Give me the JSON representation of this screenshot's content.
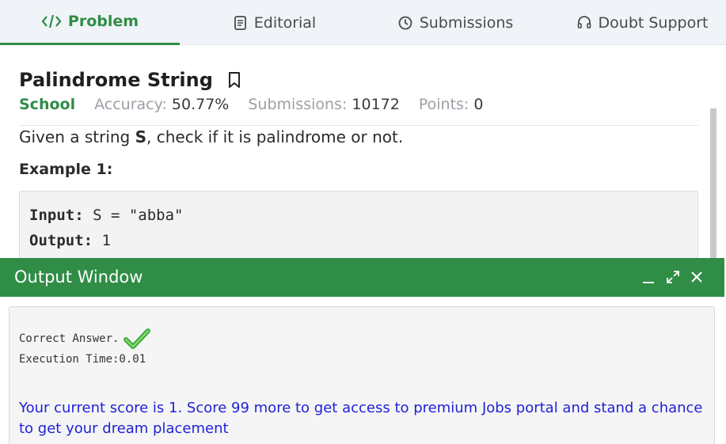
{
  "tabs": [
    {
      "label": "Problem",
      "icon": "code-icon",
      "active": true
    },
    {
      "label": "Editorial",
      "icon": "document-icon",
      "active": false
    },
    {
      "label": "Submissions",
      "icon": "clock-icon",
      "active": false
    },
    {
      "label": "Doubt Support",
      "icon": "headset-icon",
      "active": false
    }
  ],
  "problem": {
    "title": "Palindrome String",
    "level": "School",
    "accuracy_label": "Accuracy:",
    "accuracy_value": "50.77%",
    "submissions_label": "Submissions:",
    "submissions_value": "10172",
    "points_label": "Points:",
    "points_value": "0",
    "statement_prefix": "Given a string ",
    "statement_var": "S",
    "statement_suffix": ", check if it is palindrome or not.",
    "example_heading": "Example 1:",
    "example": {
      "input_label": "Input:",
      "input_value": " S = \"abba\"",
      "output_label": "Output:",
      "output_value": " 1"
    }
  },
  "output_window": {
    "title": "Output Window",
    "result": "Correct Answer.",
    "execution_time": "Execution Time:0.01",
    "score_message": "Your current score is 1. Score 99 more to get access to premium Jobs portal and stand a chance to get your dream placement"
  },
  "colors": {
    "brand_green": "#2f8d46",
    "score_blue": "#1f22d8"
  }
}
